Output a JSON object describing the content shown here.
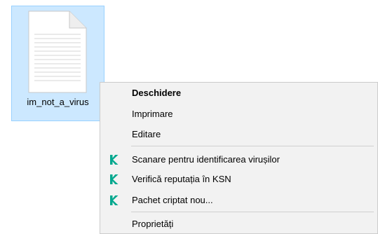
{
  "file": {
    "name": "im_not_a_virus",
    "icon": "text-document-icon"
  },
  "context_menu": {
    "items": [
      {
        "label": "Deschidere",
        "bold": true,
        "icon": null
      },
      {
        "label": "Imprimare",
        "bold": false,
        "icon": null
      },
      {
        "label": "Editare",
        "bold": false,
        "icon": null
      },
      {
        "label": "Scanare pentru identificarea virușilor",
        "bold": false,
        "icon": "kaspersky-k-icon"
      },
      {
        "label": "Verifică reputația în KSN",
        "bold": false,
        "icon": "kaspersky-k-icon"
      },
      {
        "label": "Pachet criptat nou...",
        "bold": false,
        "icon": "kaspersky-k-icon"
      },
      {
        "label": "Proprietăți",
        "bold": false,
        "icon": null
      }
    ]
  },
  "colors": {
    "selection_background": "#cce8ff",
    "selection_border": "#99d1ff",
    "menu_background": "#f2f2f2",
    "kaspersky_green": "#00a88e"
  }
}
